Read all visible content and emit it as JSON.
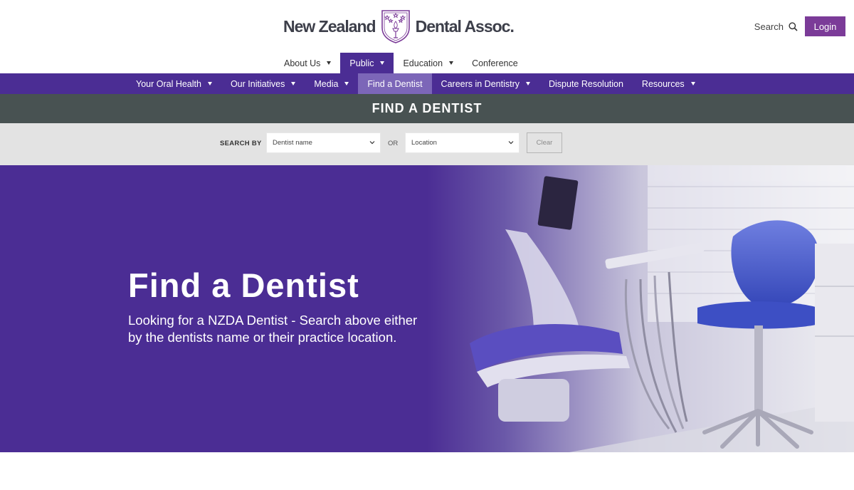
{
  "header": {
    "logo_left": "New Zealand",
    "logo_right": "Dental Assoc.",
    "search_label": "Search",
    "login_label": "Login"
  },
  "primary_nav": [
    {
      "label": "About Us",
      "has_caret": true,
      "active": false
    },
    {
      "label": "Public",
      "has_caret": true,
      "active": true
    },
    {
      "label": "Education",
      "has_caret": true,
      "active": false
    },
    {
      "label": "Conference",
      "has_caret": false,
      "active": false
    }
  ],
  "secondary_nav": [
    {
      "label": "Your Oral Health",
      "has_caret": true,
      "active": false
    },
    {
      "label": "Our Initiatives",
      "has_caret": true,
      "active": false
    },
    {
      "label": "Media",
      "has_caret": true,
      "active": false
    },
    {
      "label": "Find a Dentist",
      "has_caret": false,
      "active": true
    },
    {
      "label": "Careers in Dentistry",
      "has_caret": true,
      "active": false
    },
    {
      "label": "Dispute Resolution",
      "has_caret": false,
      "active": false
    },
    {
      "label": "Resources",
      "has_caret": true,
      "active": false
    }
  ],
  "page_title": "FIND A DENTIST",
  "search": {
    "search_by_label": "SEARCH BY",
    "dentist_select": "Dentist name",
    "or_label": "OR",
    "location_select": "Location",
    "clear_label": "Clear"
  },
  "hero": {
    "title": "Find a Dentist",
    "description": "Looking for a NZDA Dentist - Search above either by the dentists name or their practice location."
  },
  "colors": {
    "brand_purple": "#4b2d94",
    "login_purple": "#7b3b98",
    "active_subnav": "#7c66b8",
    "title_bar": "#485252",
    "search_bar": "#e3e3e3"
  }
}
